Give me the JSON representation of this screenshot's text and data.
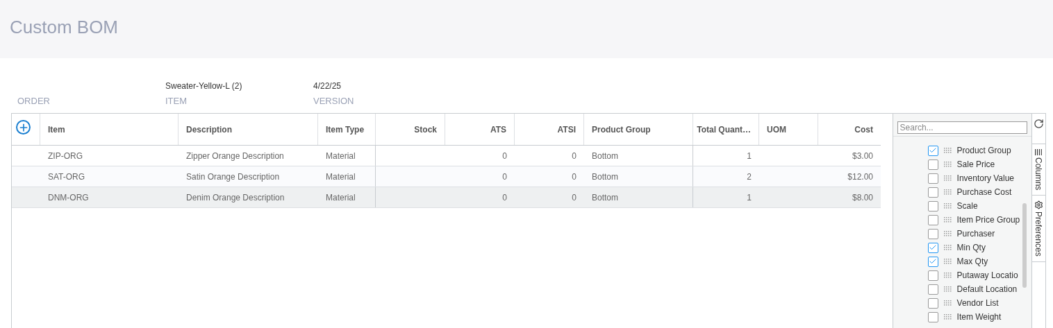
{
  "page_title": "Custom BOM",
  "fields": [
    {
      "label": "ORDER"
    },
    {
      "label": "ITEM",
      "value": "Sweater-Yellow-L (2)"
    },
    {
      "label": "VERSION",
      "value": "4/22/25"
    }
  ],
  "table": {
    "columns": [
      {
        "label": "Item"
      },
      {
        "label": "Description"
      },
      {
        "label": "Item Type"
      },
      {
        "label": "Stock"
      },
      {
        "label": "ATS"
      },
      {
        "label": "ATSI"
      },
      {
        "label": "Product Group"
      },
      {},
      {
        "label": "Total Quant…"
      },
      {
        "label": "UOM"
      },
      {
        "label": "Cost"
      }
    ],
    "rows": [
      {
        "selected": false,
        "cells": [
          "ZIP-ORG",
          "Zipper Orange Description",
          "Material",
          null,
          "0",
          "0",
          "Bottom",
          null,
          "1",
          null,
          "$3.00"
        ]
      },
      {
        "selected": false,
        "cells": [
          "SAT-ORG",
          "Satin Orange Description",
          "Material",
          null,
          "0",
          "0",
          "Bottom",
          null,
          "2",
          null,
          "$12.00"
        ]
      },
      {
        "selected": true,
        "cells": [
          "DNM-ORG",
          "Denim Orange Description",
          "Material",
          null,
          "0",
          "0",
          "Bottom",
          null,
          "1",
          null,
          "$8.00"
        ]
      }
    ]
  },
  "column_panel": {
    "search": {
      "placeholder": "Search..."
    },
    "items": [
      {
        "label": "Product Group",
        "checked": true
      },
      {
        "label": "Sale Price",
        "checked": false
      },
      {
        "label": "Inventory Value",
        "checked": false
      },
      {
        "label": "Purchase Cost",
        "checked": false
      },
      {
        "label": "Scale",
        "checked": false
      },
      {
        "label": "Item Price Group",
        "checked": false
      },
      {
        "label": "Purchaser",
        "checked": false
      },
      {
        "label": "Min Qty",
        "checked": true
      },
      {
        "label": "Max Qty",
        "checked": true
      },
      {
        "label": "Putaway Locatio",
        "checked": false
      },
      {
        "label": "Default Location",
        "checked": false
      },
      {
        "label": "Vendor List",
        "checked": false
      },
      {
        "label": "Item Weight",
        "checked": false
      }
    ]
  },
  "side_tabs": [
    {
      "label": "Columns"
    },
    {
      "label": "Preferences"
    }
  ]
}
